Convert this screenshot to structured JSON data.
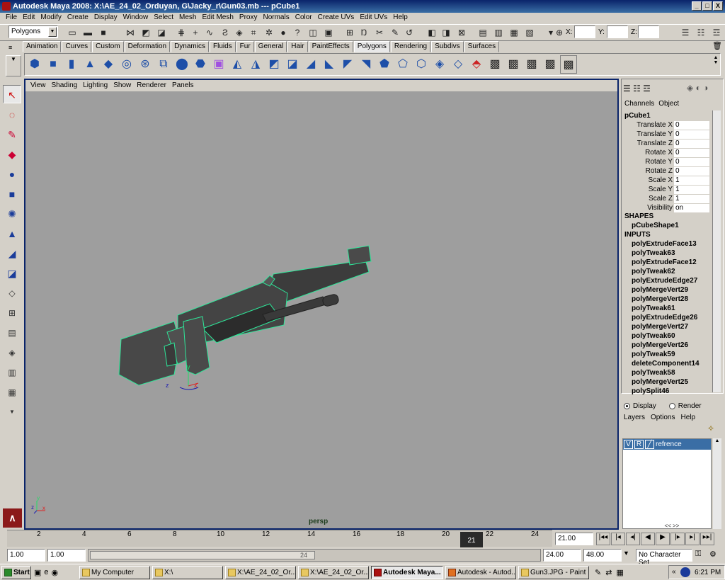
{
  "window": {
    "title": "Autodesk Maya 2008: X:\\AE_24_02_Orduyan, G\\Jacky_r\\Gun03.mb  ---  pCube1",
    "min": "_",
    "max": "□",
    "close": "X"
  },
  "menu": [
    "File",
    "Edit",
    "Modify",
    "Create",
    "Display",
    "Window",
    "Select",
    "Mesh",
    "Edit Mesh",
    "Proxy",
    "Normals",
    "Color",
    "Create UVs",
    "Edit UVs",
    "Help"
  ],
  "status": {
    "mode": "Polygons",
    "x_label": "X:",
    "y_label": "Y:",
    "z_label": "Z:"
  },
  "shelf_tabs": [
    "Animation",
    "Curves",
    "Custom",
    "Deformation",
    "Dynamics",
    "Fluids",
    "Fur",
    "General",
    "Hair",
    "PaintEffects",
    "Polygons",
    "Rendering",
    "Subdivs",
    "Surfaces"
  ],
  "shelf_selected": "Polygons",
  "viewport": {
    "menu": [
      "View",
      "Shading",
      "Lighting",
      "Show",
      "Renderer",
      "Panels"
    ],
    "camera": "persp"
  },
  "channel_box": {
    "tabs": [
      "Channels",
      "Object"
    ],
    "object": "pCube1",
    "attrs": [
      {
        "label": "Translate X",
        "value": "0"
      },
      {
        "label": "Translate Y",
        "value": "0"
      },
      {
        "label": "Translate Z",
        "value": "0"
      },
      {
        "label": "Rotate X",
        "value": "0"
      },
      {
        "label": "Rotate Y",
        "value": "0"
      },
      {
        "label": "Rotate Z",
        "value": "0"
      },
      {
        "label": "Scale X",
        "value": "1"
      },
      {
        "label": "Scale Y",
        "value": "1"
      },
      {
        "label": "Scale Z",
        "value": "1"
      },
      {
        "label": "Visibility",
        "value": "on"
      }
    ],
    "shapes_header": "SHAPES",
    "shape": "pCubeShape1",
    "inputs_header": "INPUTS",
    "inputs": [
      "polyExtrudeFace13",
      "polyTweak63",
      "polyExtrudeFace12",
      "polyTweak62",
      "polyExtrudeEdge27",
      "polyMergeVert29",
      "polyMergeVert28",
      "polyTweak61",
      "polyExtrudeEdge26",
      "polyMergeVert27",
      "polyTweak60",
      "polyMergeVert26",
      "polyTweak59",
      "deleteComponent14",
      "polyTweak58",
      "polyMergeVert25",
      "polySplit46"
    ]
  },
  "layers": {
    "display": "Display",
    "render": "Render",
    "menu": [
      "Layers",
      "Options",
      "Help"
    ],
    "layer": {
      "v": "V",
      "r": "R",
      "name": "refrence"
    }
  },
  "timeline": {
    "ticks": [
      "2",
      "4",
      "6",
      "8",
      "10",
      "12",
      "14",
      "16",
      "18",
      "20",
      "22",
      "24"
    ],
    "current": "21",
    "current_field": "21.00"
  },
  "range": {
    "start": "1.00",
    "inner_start": "1.00",
    "inner_end": "24.00",
    "end": "48.00",
    "slider_end": "24",
    "character": "No Character Set"
  },
  "taskbar": {
    "start": "Start",
    "items": [
      {
        "label": "My Computer",
        "active": false
      },
      {
        "label": "X:\\",
        "active": false
      },
      {
        "label": "X:\\AE_24_02_Or...",
        "active": false
      },
      {
        "label": "X:\\AE_24_02_Or...",
        "active": false
      },
      {
        "label": "Autodesk Maya...",
        "active": true
      },
      {
        "label": "Autodesk - Autod...",
        "active": false
      },
      {
        "label": "Gun3.JPG - Paint",
        "active": false
      }
    ],
    "clock": "6:21 PM"
  },
  "axis": {
    "x": "x",
    "y": "y",
    "z": "z"
  }
}
